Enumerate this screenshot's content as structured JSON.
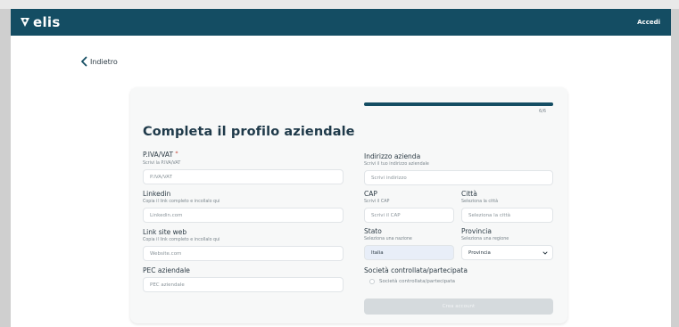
{
  "header": {
    "brand": "elis",
    "login_label": "Accedi"
  },
  "nav": {
    "back_label": "Indietro"
  },
  "progress": {
    "percent": 100,
    "label": "6/6"
  },
  "form": {
    "title": "Completa il profilo aziendale",
    "piva": {
      "label": "P.IVA/VAT",
      "required_mark": "*",
      "hint": "Scrivi la P.IVA/VAT",
      "placeholder": "P.IVA/VAT"
    },
    "linkedin": {
      "label": "Linkedin",
      "hint": "Copia il link completo e incollalo qui",
      "placeholder": "Linkedin.com"
    },
    "website": {
      "label": "Link site web",
      "hint": "Copia il link completo e incollalo qui",
      "placeholder": "Website.com"
    },
    "pec": {
      "label": "PEC aziendale",
      "placeholder": "PEC aziendale"
    },
    "address": {
      "label": "Indirizzo azienda",
      "hint": "Scrivi il tuo indirizzo aziendale",
      "placeholder": "Scrivi indirizzo"
    },
    "cap": {
      "label": "CAP",
      "hint": "Scrivi il CAP",
      "placeholder": "Scrivi il CAP"
    },
    "city": {
      "label": "Città",
      "hint": "Seleziona la città",
      "placeholder": "Seleziona la città"
    },
    "state": {
      "label": "Stato",
      "hint": "Seleziona una nazione",
      "value": "Italia"
    },
    "province": {
      "label": "Provincia",
      "hint": "Seleziona una regione",
      "value": "Provincia"
    },
    "controlled": {
      "label": "Società controllata/partecipata",
      "checkbox_label": "Società controllata/partecipata"
    },
    "submit_label": "Crea account"
  },
  "colors": {
    "brand": "#144d63",
    "selected_field": "#e8eef8",
    "disabled_button": "#d5dadd"
  },
  "icons": [
    "elis-logo-icon",
    "chevron-left-icon",
    "chevron-down-icon"
  ]
}
